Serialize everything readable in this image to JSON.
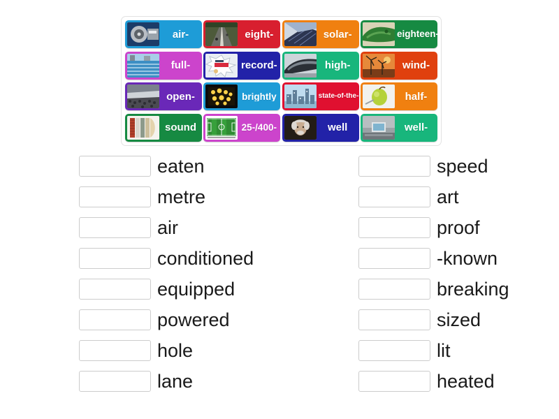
{
  "tile_bank": {
    "rows": [
      [
        {
          "label": "air-",
          "color": "#1e9cd7",
          "image": "jet-engine-photo"
        },
        {
          "label": "eight-",
          "color": "#d81f2f",
          "image": "highway-lanes-photo"
        },
        {
          "label": "solar-",
          "color": "#f08010",
          "image": "solar-panel-photo"
        },
        {
          "label": "eighteen-",
          "color": "#168a42",
          "image": "golf-course-photo"
        }
      ],
      [
        {
          "label": "full-",
          "color": "#cc44cc",
          "image": "swimming-pool-photo"
        },
        {
          "label": "record-",
          "color": "#2222a8",
          "image": "record-breaker-badge-photo"
        },
        {
          "label": "high-",
          "color": "#18b67c",
          "image": "bullet-train-photo"
        },
        {
          "label": "wind-",
          "color": "#e0400e",
          "image": "wind-turbines-photo"
        }
      ],
      [
        {
          "label": "open-",
          "color": "#6a28b8",
          "image": "stadium-crowd-photo"
        },
        {
          "label": "brightly",
          "color": "#1e9cd7",
          "image": "stage-lights-photo"
        },
        {
          "label": "state-of-the-",
          "color": "#e01030",
          "image": "city-skyline-photo"
        },
        {
          "label": "half-",
          "color": "#f08010",
          "image": "apple-photo"
        }
      ],
      [
        {
          "label": "sound",
          "color": "#168a42",
          "image": "insulation-layers-photo"
        },
        {
          "label": "25-/400-",
          "color": "#cc44cc",
          "image": "football-pitch-photo"
        },
        {
          "label": "well",
          "color": "#2222a8",
          "image": "einstein-portrait-photo"
        },
        {
          "label": "well-",
          "color": "#18b67c",
          "image": "lecture-room-photo"
        }
      ]
    ]
  },
  "answers": {
    "left_column": [
      {
        "text": "eaten"
      },
      {
        "text": "metre"
      },
      {
        "text": "air"
      },
      {
        "text": "conditioned"
      },
      {
        "text": "equipped"
      },
      {
        "text": "powered"
      },
      {
        "text": "hole"
      },
      {
        "text": "lane"
      }
    ],
    "right_column": [
      {
        "text": "speed"
      },
      {
        "text": "art"
      },
      {
        "text": "proof"
      },
      {
        "text": "-known"
      },
      {
        "text": "breaking"
      },
      {
        "text": "sized"
      },
      {
        "text": "lit"
      },
      {
        "text": "heated"
      }
    ]
  }
}
